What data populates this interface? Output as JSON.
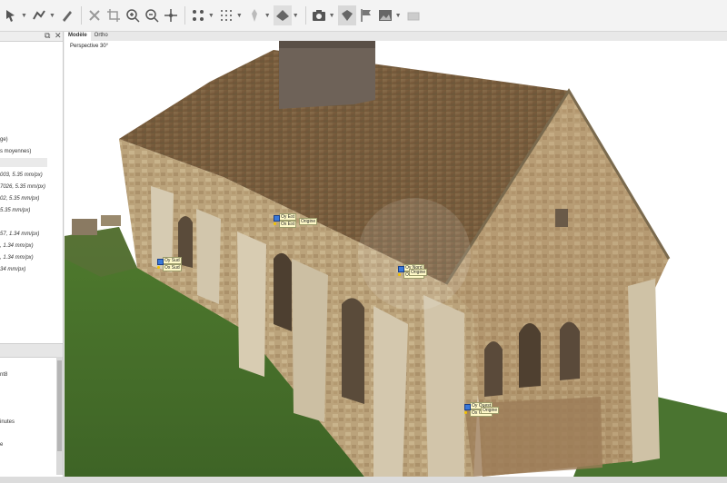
{
  "toolbar": {
    "icons": [
      "select-icon",
      "polyline-icon",
      "draw-icon",
      "eraser-icon",
      "close-icon",
      "crop-icon",
      "zoom-in-icon",
      "zoom-out-icon",
      "move-icon",
      "points-icon",
      "grid-icon",
      "tie-icon",
      "mesh-icon",
      "camera-icon",
      "marker-icon",
      "flag-icon",
      "image-icon",
      "panel-icon"
    ]
  },
  "left_panel": {
    "lines": [
      "ge)",
      "s moyennes)",
      "003, 5.35 mm/px)",
      "7026, 5.35 mm/px)",
      "02, 5.35 mm/px)",
      "5.35 mm/px)",
      "57, 1.34 mm/px)",
      ", 1.34 mm/px)",
      ", 1.34 mm/px)",
      "34 mm/px)"
    ],
    "lower_lines": [
      "nt8",
      "inutes",
      "e"
    ]
  },
  "viewport": {
    "tabs": [
      "Modèle",
      "Ortho"
    ],
    "active_tab": "Modèle",
    "perspective": "Perspective 30°"
  },
  "markers": {
    "est": [
      "Oy Est",
      "Ox Est",
      "Origine"
    ],
    "sud": [
      "Oy Sud",
      "Ox Sud"
    ],
    "nord": [
      "Oy Nord",
      "Ox Nord",
      "Origine"
    ],
    "ouest": [
      "Oy Ouest",
      "Ox Ouest",
      "Origine"
    ]
  }
}
